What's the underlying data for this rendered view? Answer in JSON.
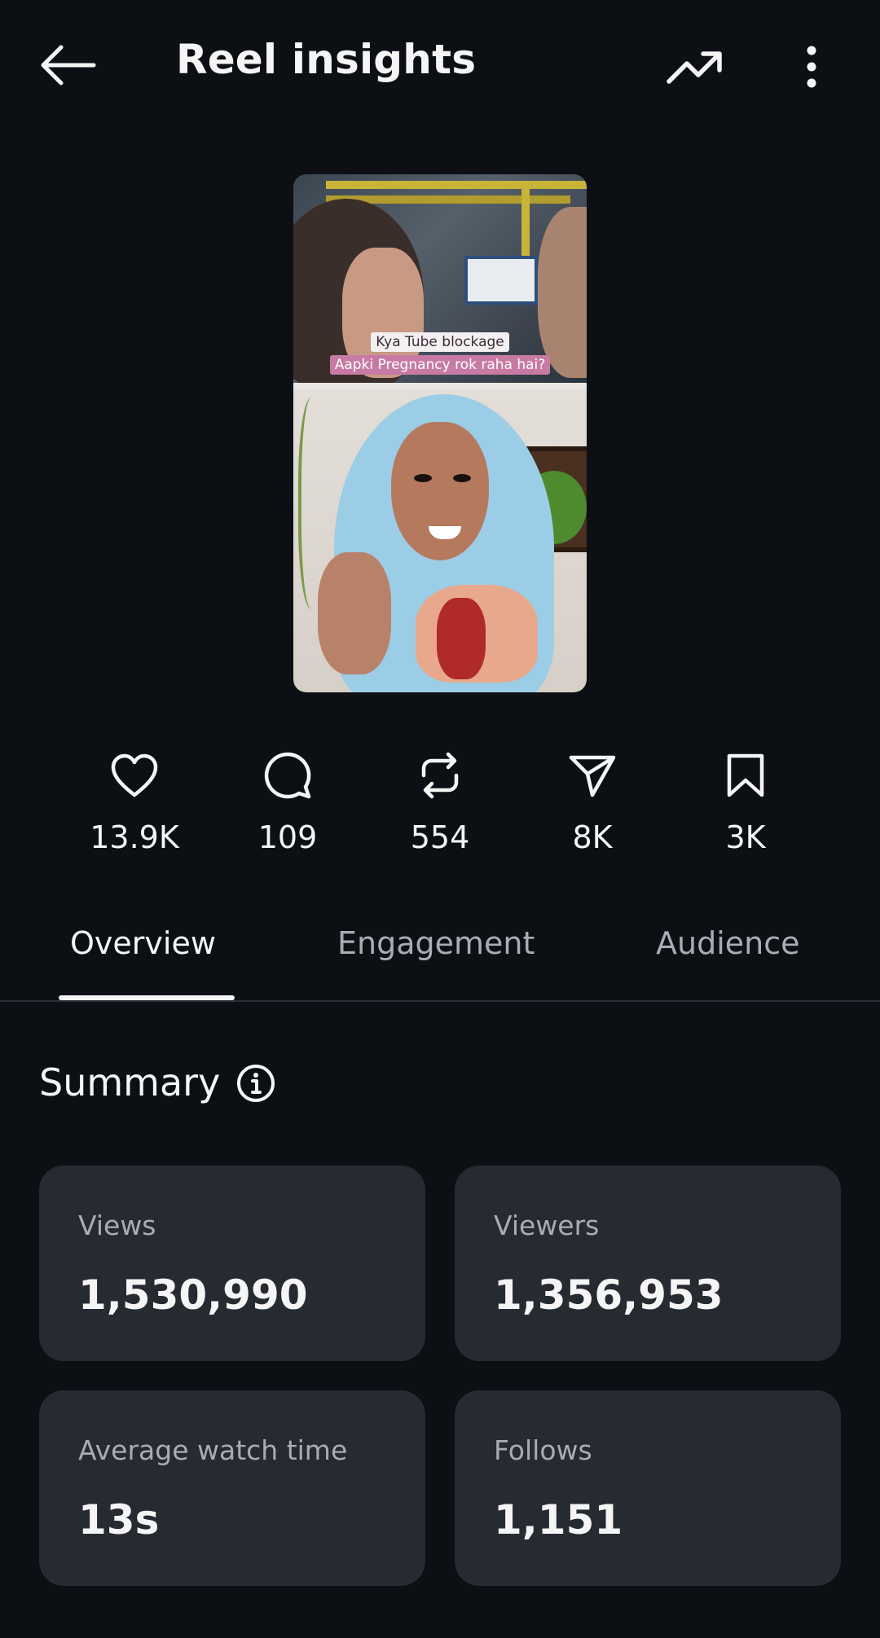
{
  "header": {
    "title": "Reel insights",
    "back_icon": "arrow-left-icon",
    "trend_icon": "trending-up-icon",
    "more_icon": "more-vertical-icon"
  },
  "thumbnail": {
    "caption_line1": "Kya Tube blockage",
    "caption_line2": "Aapki Pregnancy rok raha hai?"
  },
  "stats": [
    {
      "icon": "heart-icon",
      "value": "13.9K"
    },
    {
      "icon": "comment-icon",
      "value": "109"
    },
    {
      "icon": "repost-icon",
      "value": "554"
    },
    {
      "icon": "share-icon",
      "value": "8K"
    },
    {
      "icon": "bookmark-icon",
      "value": "3K"
    }
  ],
  "tabs": [
    {
      "label": "Overview",
      "active": true
    },
    {
      "label": "Engagement",
      "active": false
    },
    {
      "label": "Audience",
      "active": false
    }
  ],
  "summary": {
    "title": "Summary",
    "cards": [
      {
        "label": "Views",
        "value": "1,530,990"
      },
      {
        "label": "Viewers",
        "value": "1,356,953"
      },
      {
        "label": "Average watch time",
        "value": "13s"
      },
      {
        "label": "Follows",
        "value": "1,151"
      }
    ]
  },
  "colors": {
    "background": "#0c1014",
    "card": "#262a31",
    "text": "#f5f5f5",
    "muted": "#a8adb4"
  }
}
